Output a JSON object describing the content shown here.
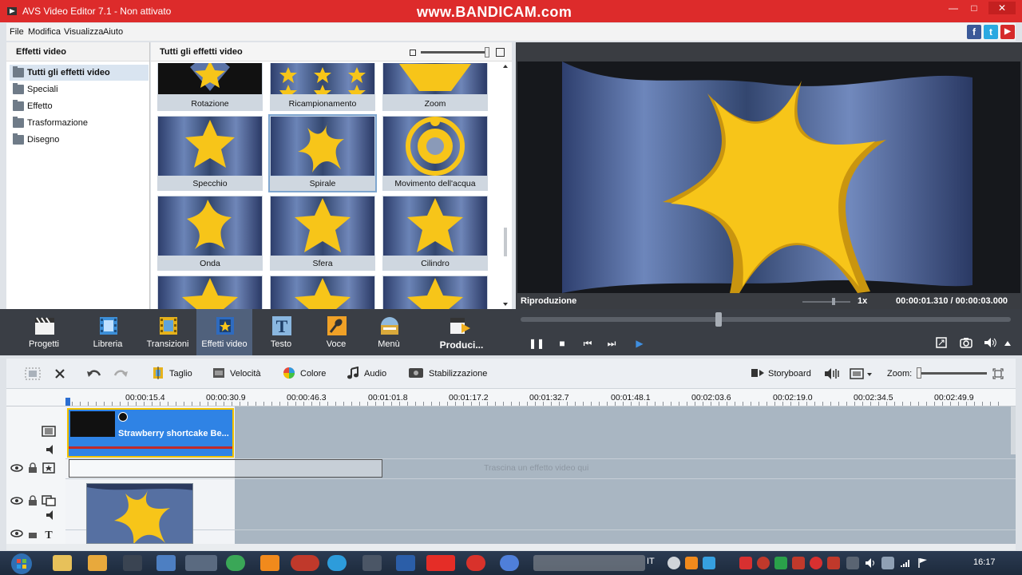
{
  "titlebar": {
    "title": "AVS Video Editor 7.1 - Non attivato",
    "watermark": "www.BANDICAM.com",
    "minimize": "—",
    "maximize": "□",
    "close": "✕"
  },
  "menu": [
    "File",
    "Modifica",
    "Visualizza",
    "Aiuto"
  ],
  "social": {
    "facebook": "f",
    "twitter": "t",
    "youtube": "▶"
  },
  "effects_panel": {
    "header": "Effetti video",
    "categories": [
      {
        "label": "Tutti gli effetti video",
        "selected": true
      },
      {
        "label": "Speciali"
      },
      {
        "label": "Effetto"
      },
      {
        "label": "Trasformazione"
      },
      {
        "label": "Disegno"
      }
    ]
  },
  "gallery": {
    "header": "Tutti gli effetti video",
    "items": [
      "Rotazione",
      "Ricampionamento",
      "Zoom",
      "Specchio",
      "Spirale",
      "Movimento dell'acqua",
      "Onda",
      "Sfera",
      "Cilindro"
    ],
    "selected": "Spirale"
  },
  "preview": {
    "status": "Riproduzione",
    "speed": "1x",
    "time": "00:00:01.310 / 00:00:03.000"
  },
  "toolbar": {
    "items": [
      {
        "label": "Progetti",
        "icon": "clapper-icon"
      },
      {
        "label": "Libreria",
        "icon": "film-icon"
      },
      {
        "label": "Transizioni",
        "icon": "transition-icon"
      },
      {
        "label": "Effetti video",
        "icon": "star-effect-icon",
        "active": true
      },
      {
        "label": "Testo",
        "icon": "text-icon"
      },
      {
        "label": "Voce",
        "icon": "microphone-icon"
      },
      {
        "label": "Menù",
        "icon": "menu-disc-icon"
      },
      {
        "label": "Produci...",
        "icon": "produce-icon"
      }
    ]
  },
  "playback": {
    "pause": "❚❚",
    "stop": "■",
    "prev": "⏮",
    "next": "⏭",
    "frame": "▶"
  },
  "timeline_toolbar": {
    "cut": "Taglio",
    "speed": "Velocità",
    "color": "Colore",
    "audio": "Audio",
    "stabilize": "Stabilizzazione",
    "storyboard": "Storyboard",
    "zoom": "Zoom:"
  },
  "ruler": [
    "00:00:15.4",
    "00:00:30.9",
    "00:00:46.3",
    "00:01:01.8",
    "00:01:17.2",
    "00:01:32.7",
    "00:01:48.1",
    "00:02:03.6",
    "00:02:19.0",
    "00:02:34.5",
    "00:02:49.9"
  ],
  "timeline": {
    "clip_label": "Strawberry shortcake Be...",
    "drop_hint": "Trascina un effetto video qui"
  },
  "taskbar": {
    "lang": "IT",
    "clock": "16:17"
  },
  "colors": {
    "titlebar": "#dd2b2b",
    "toolbar_bg": "#3a3e45",
    "clip": "#2f83e5",
    "clip_border": "#f2c200",
    "star": "#f7c519"
  }
}
